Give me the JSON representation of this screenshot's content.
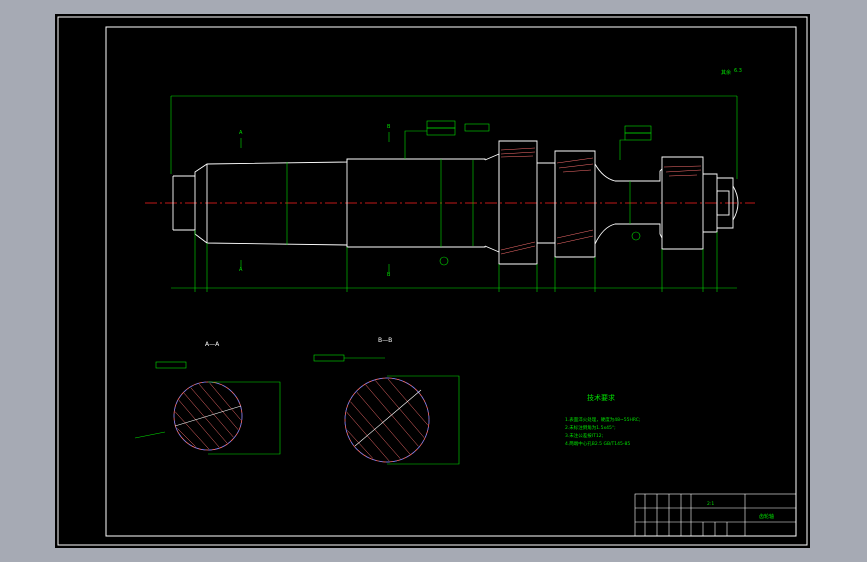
{
  "drawing": {
    "title_block_name": "齿轮轴",
    "title_block_scale": "2:1",
    "roughness_note": "其余",
    "roughness_value": "6.3"
  },
  "sections": {
    "aa_label": "A—A",
    "bb_label": "B—B",
    "aa_marker_top": "A",
    "aa_marker_bottom": "A",
    "bb_marker_top": "B",
    "bb_marker_bottom": "B"
  },
  "tech_requirements": {
    "title": "技术要求",
    "items": [
      "1.表面淬火处理，硬度为48~55HRC;",
      "2.未标注倒角为1.5x45°;",
      "3.未注公差按IT12;",
      "4.两端中心孔B2.5 GB/T145-85"
    ]
  },
  "colors": {
    "outline": "#ffffff",
    "dimension": "#00e000",
    "centerline": "#ff2020",
    "section": "#5a7cff",
    "hatch": "#ff7070"
  }
}
